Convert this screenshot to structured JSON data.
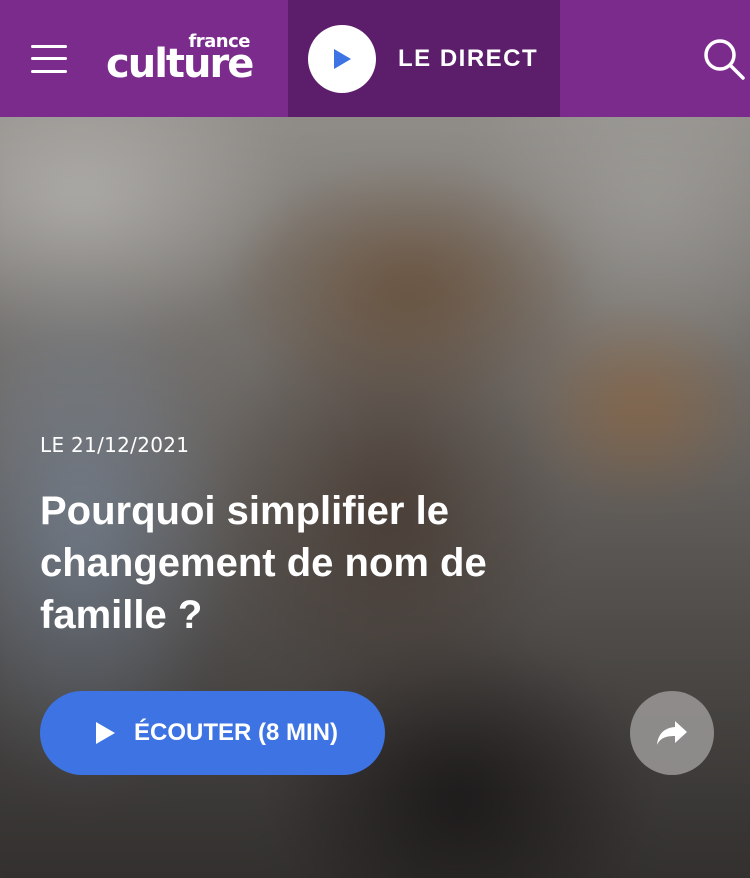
{
  "header": {
    "logo_top": "france",
    "logo_main": "culture",
    "live_label": "LE DIRECT",
    "menu_icon": "hamburger-menu-icon",
    "search_icon": "search-icon",
    "colors": {
      "header_bg": "#7a2b8c",
      "live_bg": "#5c1e6b",
      "play_icon": "#3d73e2"
    }
  },
  "article": {
    "date": "LE 21/12/2021",
    "title": "Pourquoi simplifier le changement de nom de famille ?",
    "listen_label": "ÉCOUTER (8 MIN)",
    "listen_icon": "play-icon",
    "share_icon": "share-arrow-icon",
    "colors": {
      "listen_bg": "#3d73e2",
      "share_bg": "#969492"
    }
  }
}
